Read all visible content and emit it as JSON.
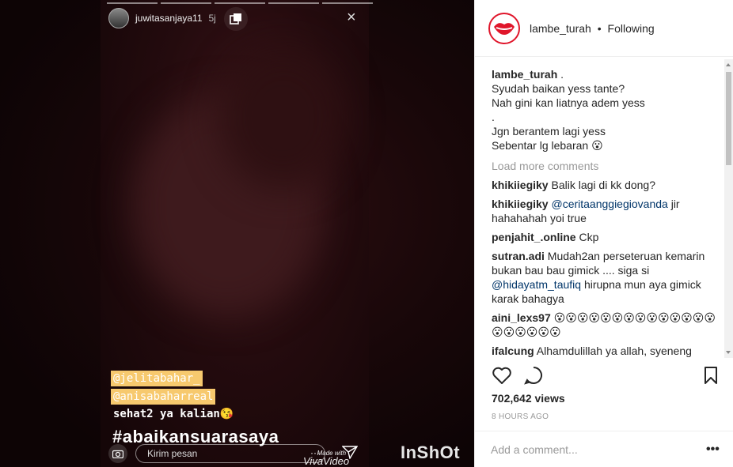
{
  "story": {
    "username": "juwitasanjaya11",
    "time": "5j",
    "close_icon": "×",
    "tags": [
      "@jelitabahar_",
      "@anisabaharreal"
    ],
    "text_line": "sehat2 ya kalian😘",
    "hashtag": "#abaikansuarasaya",
    "reply_placeholder": "Kirim pesan",
    "more_label": "···",
    "watermark_viva_top": "Made with",
    "watermark_viva_bottom": "VivaVideo",
    "watermark_inshot": "InShOt"
  },
  "post": {
    "account": "lambe_turah",
    "separator": "•",
    "follow_status": "Following",
    "caption_user": "lambe_turah",
    "caption_lines": [
      ".",
      "Syudah baikan yess tante?",
      "Nah gini kan liatnya adem yess",
      ".",
      "Jgn berantem lagi yess",
      "Sebentar lg lebaran 😮"
    ],
    "load_more": "Load more comments",
    "comments": [
      {
        "user": "khikiiegiky",
        "text": "Balik lagi di kk dong?"
      },
      {
        "user": "khikiiegiky",
        "mention": "@ceritaanggiegiovanda",
        "text": "jir hahahahah yoi true"
      },
      {
        "user": "penjahit_.online",
        "text": "Ckp"
      },
      {
        "user": "sutran.adi",
        "text": "Mudah2an perseteruan kemarin bukan bau bau gimick .... siga si",
        "mention": "@hidayatm_taufiq",
        "text2": "hirupna mun aya gimick karak bahagya"
      },
      {
        "user": "aini_lexs97",
        "text": "😮😮😮😮😮😮😮😮😮😮😮😮😮😮😮😮😮😮😮😮"
      },
      {
        "user": "ifalcung",
        "text": "Alhamdulillah ya allah, syeneng"
      }
    ],
    "views": "702,642 views",
    "time_ago": "8 HOURS AGO",
    "comment_placeholder": "Add a comment...",
    "more_label": "•••"
  },
  "colors": {
    "mention": "#003569",
    "brand_red": "#e0162b",
    "tag_bg": "#f7c96e"
  }
}
